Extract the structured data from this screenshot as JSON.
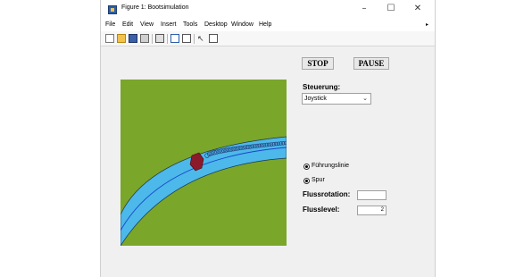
{
  "window": {
    "title": "Figure 1: Bootsimulation",
    "minimize": "–",
    "maximize": "☐",
    "close": "✕"
  },
  "menu": [
    "File",
    "Edit",
    "View",
    "Insert",
    "Tools",
    "Desktop",
    "Window",
    "Help"
  ],
  "menu_overflow": "▸",
  "toolbar": [
    "new-file-icon",
    "open-folder-icon",
    "save-icon",
    "print-icon",
    "print-preview-icon",
    "link-plot-icon",
    "insert-colorbar-icon",
    "edit-plot-arrow-icon",
    "property-inspector-icon"
  ],
  "controls": {
    "stop_label": "STOP",
    "pause_label": "PAUSE",
    "steuerung_label": "Steuerung:",
    "steuerung_value": "Joystick",
    "radio1_label": "Führungslinie",
    "radio2_label": "Spur",
    "flussrotation_label": "Flussrotation:",
    "flussrotation_value": "",
    "flusslevel_label": "Flusslevel:",
    "flusslevel_value": "2"
  },
  "colors": {
    "land": "#7aa62a",
    "river": "#4db8ea",
    "boat": "#8b1a2b",
    "guide": "#1446c8",
    "trail": "#24407a"
  }
}
